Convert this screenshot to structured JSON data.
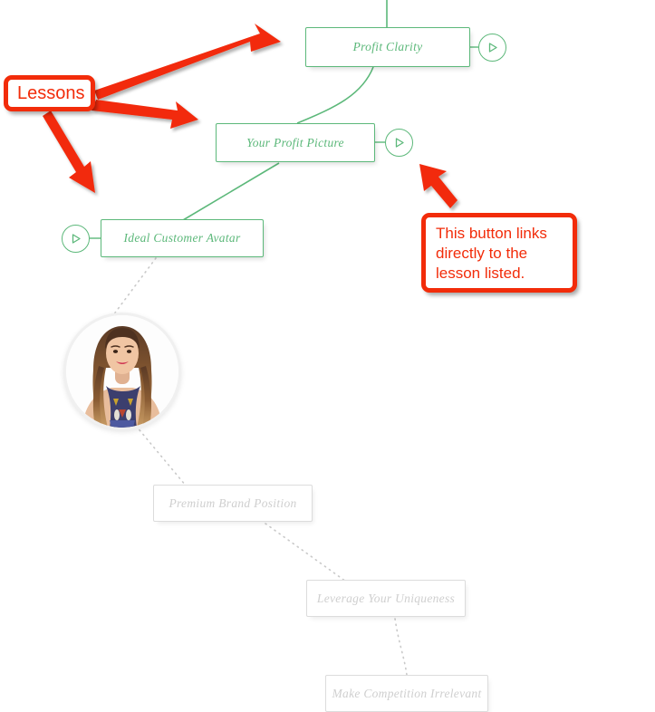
{
  "diagram": {
    "title": "Course lesson mind map",
    "colors": {
      "active_green": "#5cb87a",
      "inactive_grey": "#cfcfcf",
      "annotation_red": "#f22c0a",
      "background": "#ffffff"
    },
    "nodes": [
      {
        "id": "profit-clarity",
        "label": "Profit Clarity",
        "state": "active",
        "has_play_button": true,
        "play_button_side": "right"
      },
      {
        "id": "your-profit-picture",
        "label": "Your Profit Picture",
        "state": "active",
        "has_play_button": true,
        "play_button_side": "right"
      },
      {
        "id": "ideal-customer-avatar",
        "label": "Ideal Customer Avatar",
        "state": "active",
        "has_play_button": true,
        "play_button_side": "left"
      },
      {
        "id": "premium-brand-position",
        "label": "Premium Brand Position",
        "state": "inactive",
        "has_play_button": false,
        "play_button_side": "none"
      },
      {
        "id": "leverage-your-uniqueness",
        "label": "Leverage Your Uniqueness",
        "state": "inactive",
        "has_play_button": false,
        "play_button_side": "none"
      },
      {
        "id": "make-competition-irrelevant",
        "label": "Make Competition Irrelevant",
        "state": "inactive",
        "has_play_button": false,
        "play_button_side": "none"
      }
    ],
    "avatar": {
      "name": "instructor-avatar",
      "alt": "Instructor portrait photo"
    },
    "annotations": [
      {
        "id": "lessons",
        "text": "Lessons",
        "arrow_count": 3
      },
      {
        "id": "button-note",
        "text": "This button links directly to the lesson listed.",
        "arrow_count": 1
      }
    ],
    "icons": {
      "play": "play-icon"
    }
  }
}
